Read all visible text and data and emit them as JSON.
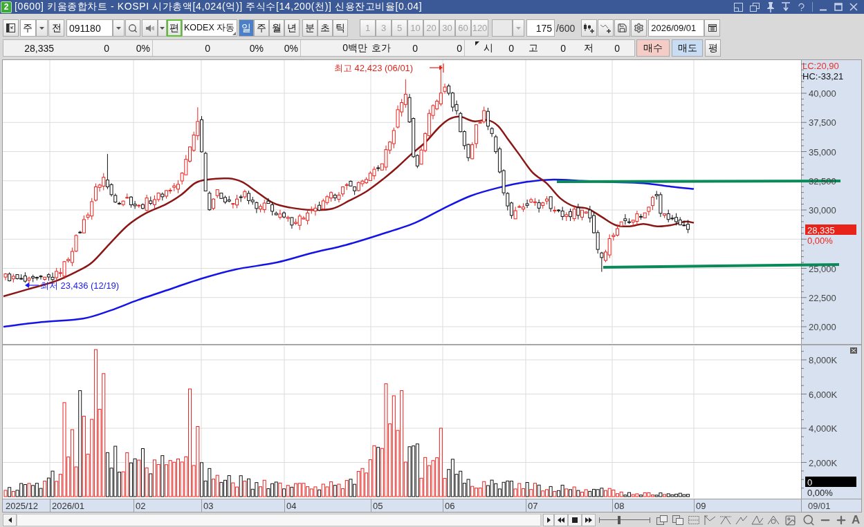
{
  "window": {
    "badge": "2",
    "title": "[0600] 키움종합차트 - KOSPI 시가총액[4,024(억)] 주식수[14,200(천)] 신용잔고비율[0.04]"
  },
  "toolbar": {
    "market": "주",
    "prev_button": "전",
    "stock_code": "091180",
    "edit_button": "편",
    "stock_name": "KODEX 자동",
    "periods": [
      {
        "label": "일",
        "selected": true
      },
      {
        "label": "주",
        "selected": false
      },
      {
        "label": "월",
        "selected": false
      },
      {
        "label": "년",
        "selected": false
      }
    ],
    "intraday_periods": [
      {
        "label": "분",
        "selected": false
      },
      {
        "label": "초",
        "selected": false
      },
      {
        "label": "틱",
        "selected": false
      }
    ],
    "intervals": [
      {
        "label": "1",
        "disabled": true
      },
      {
        "label": "3",
        "disabled": true
      },
      {
        "label": "5",
        "disabled": true
      },
      {
        "label": "10",
        "disabled": true
      },
      {
        "label": "20",
        "disabled": true
      },
      {
        "label": "30",
        "disabled": true
      },
      {
        "label": "60",
        "disabled": true
      },
      {
        "label": "120",
        "disabled": true
      }
    ],
    "interval_select": {
      "disabled": true
    },
    "count": "175",
    "count_max": "/600",
    "date": "2026/09/01"
  },
  "quote_bar": {
    "cells": [
      {
        "kind": "value",
        "text": "28,335"
      },
      {
        "kind": "value",
        "text": "0"
      },
      {
        "kind": "value",
        "text": "0%"
      },
      {
        "kind": "value",
        "text": "0"
      },
      {
        "kind": "value",
        "text": "0%"
      },
      {
        "kind": "value",
        "text": "0%"
      },
      {
        "kind": "value",
        "text": "0백만"
      },
      {
        "kind": "label",
        "text": "호가"
      },
      {
        "kind": "value",
        "text": "0"
      },
      {
        "kind": "value",
        "text": "0"
      },
      {
        "kind": "label",
        "text": "시"
      },
      {
        "kind": "value",
        "text": "0"
      },
      {
        "kind": "label",
        "text": "고"
      },
      {
        "kind": "value",
        "text": "0"
      },
      {
        "kind": "label",
        "text": "저"
      },
      {
        "kind": "value",
        "text": "0"
      }
    ],
    "buttons": [
      {
        "kind": "buy",
        "label": "매수"
      },
      {
        "kind": "sell",
        "label": "매도"
      },
      {
        "kind": "plain",
        "label": "평"
      }
    ]
  },
  "chart": {
    "indicators": [
      {
        "text": "LC:20,90",
        "color": "#e8302a"
      },
      {
        "text": "HC:-33,21",
        "color": "#111111"
      }
    ],
    "price_labels": [
      "40,000",
      "37,500",
      "35,000",
      "32,500",
      "30,000",
      "25,000",
      "22,500",
      "20,000"
    ],
    "current_price": "28,335",
    "price_change": "0,00%",
    "high_marker": "최고 42,423 (06/01)",
    "low_marker": "최저 23,436 (12/19)",
    "volume_labels": [
      "8,000K",
      "6,000K",
      "4,000K",
      "2,000K"
    ],
    "current_volume": "0",
    "volume_change": "0,00%",
    "date_labels": [
      "2025/12",
      "2026/01",
      "02",
      "03",
      "04",
      "05",
      "06",
      "07",
      "08",
      "09"
    ],
    "cursor_date": "09/01"
  },
  "bottom_bar": {
    "zoom_slider": {
      "level": 0.39
    },
    "text_tool": "A"
  }
}
